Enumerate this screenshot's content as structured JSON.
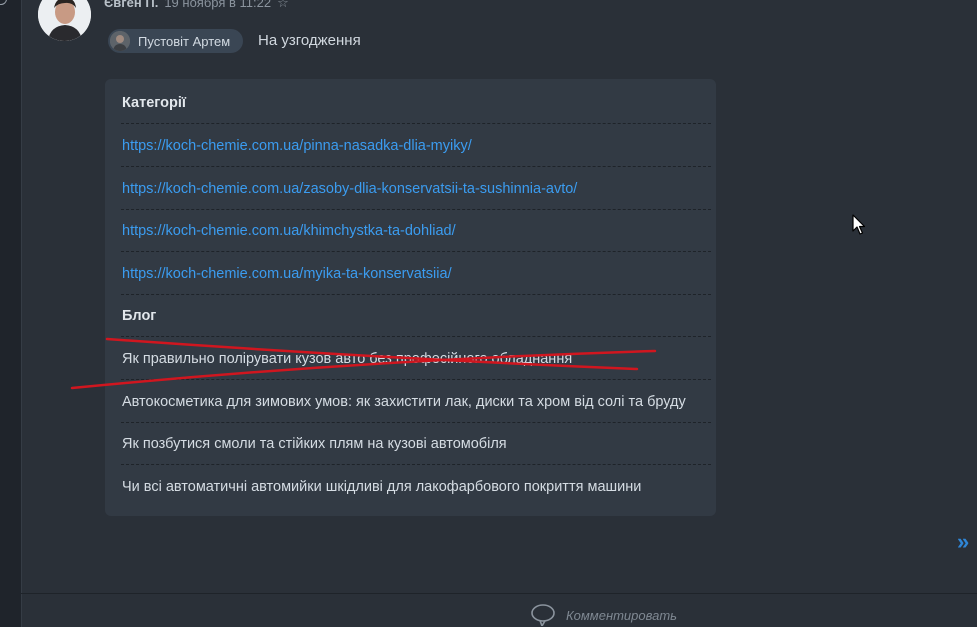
{
  "comment": {
    "author": "Євген П.",
    "date": "19 ноября в 11:22",
    "mention": "Пустовіт Артем",
    "status": "На узгодження"
  },
  "card": {
    "rows": [
      {
        "kind": "header",
        "text": "Категорії"
      },
      {
        "kind": "link",
        "text": "https://koch-chemie.com.ua/pinna-nasadka-dlia-myiky/"
      },
      {
        "kind": "link",
        "text": "https://koch-chemie.com.ua/zasoby-dlia-konservatsii-ta-sushinnia-avto/"
      },
      {
        "kind": "link",
        "text": "https://koch-chemie.com.ua/khimchystka-ta-dohliad/"
      },
      {
        "kind": "link",
        "text": "https://koch-chemie.com.ua/myika-ta-konservatsiia/"
      },
      {
        "kind": "header",
        "text": "Блог"
      },
      {
        "kind": "text",
        "text": "Як правильно полірувати кузов авто без професійного обладнання"
      },
      {
        "kind": "text",
        "text": "Автокосметика для зимових умов: як захистити лак, диски та хром від солі та бруду"
      },
      {
        "kind": "text",
        "text": "Як позбутися смоли та стійких плям на кузові автомобіля"
      },
      {
        "kind": "text",
        "text": "Чи всі автоматичні автомийки шкідливі для лакофарбового покриття машини"
      }
    ]
  },
  "footer": {
    "comment_label": "Комментировать",
    "next_arrow": "»"
  },
  "colors": {
    "background": "#2a3038",
    "card": "#323a44",
    "link": "#3b9cf0",
    "strike": "#d0161f"
  }
}
